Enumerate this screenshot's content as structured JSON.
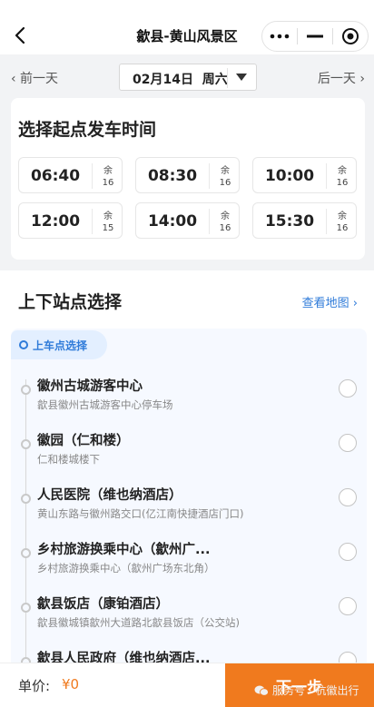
{
  "header": {
    "title": "歙县-黄山风景区"
  },
  "date_bar": {
    "prev": "‹ 前一天",
    "next": "后一天 ›",
    "date": "02月14日",
    "weekday": "周六"
  },
  "departure": {
    "title": "选择起点发车时间",
    "slots": [
      {
        "time": "06:40",
        "seat_label": "余",
        "seats": "16"
      },
      {
        "time": "08:30",
        "seat_label": "余",
        "seats": "16"
      },
      {
        "time": "10:00",
        "seat_label": "余",
        "seats": "16"
      },
      {
        "time": "12:00",
        "seat_label": "余",
        "seats": "15"
      },
      {
        "time": "14:00",
        "seat_label": "余",
        "seats": "16"
      },
      {
        "time": "15:30",
        "seat_label": "余",
        "seats": "16"
      }
    ]
  },
  "stations": {
    "title": "上下站点选择",
    "map_link": "查看地图 ›",
    "tag": "上车点选择",
    "stops": [
      {
        "name": "徽州古城游客中心",
        "address": "歙县徽州古城游客中心停车场"
      },
      {
        "name": "徽园（仁和楼）",
        "address": "仁和楼城楼下"
      },
      {
        "name": "人民医院（维也纳酒店）",
        "address": "黄山东路与徽州路交口(亿江南快捷酒店门口)"
      },
      {
        "name": "乡村旅游换乘中心（歙州广...",
        "address": "乡村旅游换乘中心（歙州广场东北角）"
      },
      {
        "name": "歙县饭店（康铂酒店）",
        "address": "歙县徽城镇歙州大道路北歙县饭店（公交站)"
      },
      {
        "name": "歙县人民政府（维也纳酒店...",
        "address": ""
      }
    ]
  },
  "footer": {
    "price_label": "单价:",
    "price_value": "¥0",
    "next_label": "下一步"
  },
  "watermark": {
    "text": "服务号 · 杭徽出行"
  },
  "colors": {
    "accent": "#f07a1e",
    "link": "#2f7bd9"
  }
}
